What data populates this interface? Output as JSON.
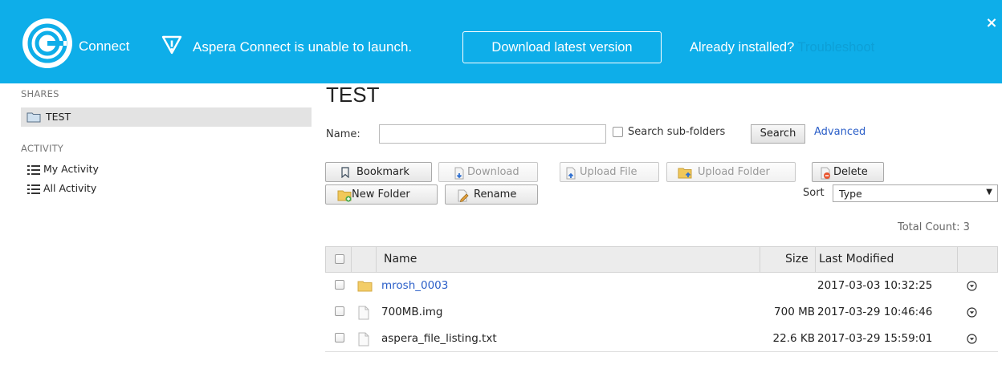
{
  "banner": {
    "brand": "Connect",
    "message": "Aspera Connect is unable to launch.",
    "download_button": "Download latest version",
    "already_installed": "Already installed?",
    "troubleshoot": "Troubleshoot",
    "close": "×",
    "colors": {
      "background": "#0eaee9",
      "troubleshoot_link": "#0d9fd6"
    }
  },
  "sidebar": {
    "shares_heading": "SHARES",
    "shares": [
      {
        "label": "TEST",
        "icon": "folder-icon",
        "selected": true
      }
    ],
    "activity_heading": "ACTIVITY",
    "activity": [
      {
        "label": "My Activity",
        "icon": "list-icon"
      },
      {
        "label": "All Activity",
        "icon": "list-icon"
      }
    ]
  },
  "main": {
    "title": "TEST",
    "search": {
      "name_label": "Name:",
      "value": "",
      "subfolders_label": "Search sub-folders",
      "subfolders_checked": false,
      "search_button": "Search",
      "advanced_link": "Advanced"
    },
    "toolbar": {
      "bookmark": "Bookmark",
      "download": "Download",
      "upload_file": "Upload File",
      "upload_folder": "Upload Folder",
      "delete": "Delete",
      "new_folder": "New Folder",
      "rename": "Rename"
    },
    "sort": {
      "label": "Sort",
      "value": "Type"
    },
    "total_count": "Total Count: 3",
    "table": {
      "columns": {
        "name": "Name",
        "size": "Size",
        "modified": "Last Modified"
      },
      "rows": [
        {
          "name": "mrosh_0003",
          "type": "folder",
          "size": "",
          "modified": "2017-03-03 10:32:25"
        },
        {
          "name": "700MB.img",
          "type": "file",
          "size": "700 MB",
          "modified": "2017-03-29 10:46:46"
        },
        {
          "name": "aspera_file_listing.txt",
          "type": "file",
          "size": "22.6 KB",
          "modified": "2017-03-29 15:59:01"
        }
      ]
    }
  }
}
